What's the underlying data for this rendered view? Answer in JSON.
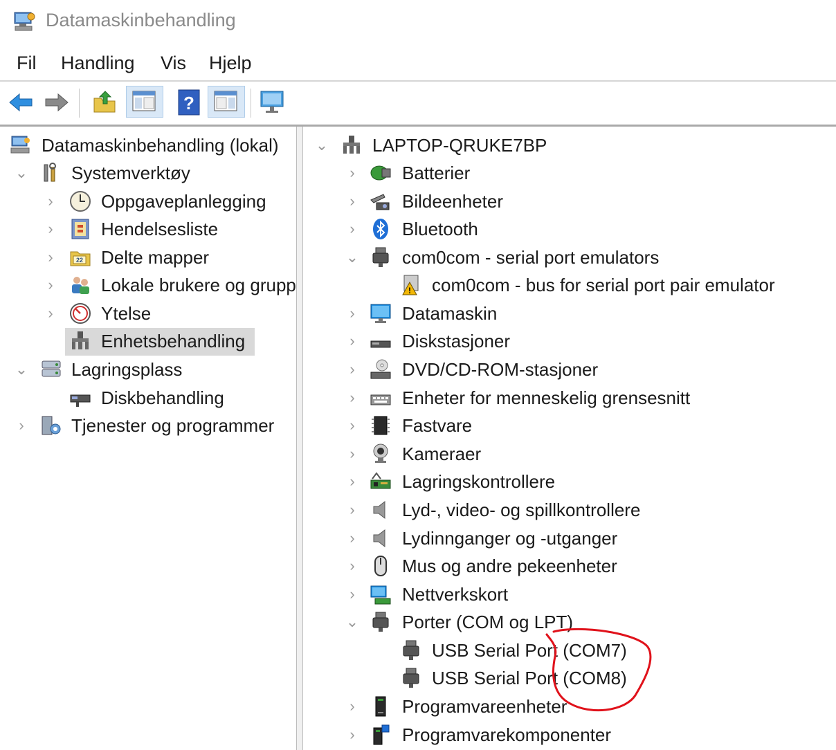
{
  "window": {
    "title": "Datamaskinbehandling"
  },
  "menu": [
    "Fil",
    "Handling",
    "Vis",
    "Hjelp"
  ],
  "toolbar": {
    "buttons": [
      "back-icon",
      "forward-icon",
      "up-folder-icon",
      "show-hide-console-tree-icon",
      "help-icon",
      "show-hide-action-pane-icon",
      "monitor-icon"
    ]
  },
  "tree": {
    "root": "Datamaskinbehandling (lokal)",
    "systemverktoy": "Systemverktøy",
    "oppgaveplanlegging": "Oppgaveplanlegging",
    "hendelsesliste": "Hendelsesliste",
    "delte_mapper": "Delte mapper",
    "lokale_brukere": "Lokale brukere og grupper",
    "ytelse": "Ytelse",
    "enhetsbehandling": "Enhetsbehandling",
    "lagringsplass": "Lagringsplass",
    "diskbehandling": "Diskbehandling",
    "tjenester": "Tjenester og programmer"
  },
  "devices": {
    "computer": "LAPTOP-QRUKE7BP",
    "batterier": "Batterier",
    "bildeenheter": "Bildeenheter",
    "bluetooth": "Bluetooth",
    "com0com": "com0com - serial port emulators",
    "com0com_bus": "com0com - bus for serial port pair emulator",
    "datamaskin": "Datamaskin",
    "diskstasjoner": "Diskstasjoner",
    "dvd": "DVD/CD-ROM-stasjoner",
    "hid": "Enheter for menneskelig grensesnitt",
    "fastvare": "Fastvare",
    "kameraer": "Kameraer",
    "lagringskontrollere": "Lagringskontrollere",
    "lyd_video": "Lyd-, video- og spillkontrollere",
    "lydinnganger": "Lydinnganger og -utganger",
    "mus": "Mus og andre pekeenheter",
    "nettverkskort": "Nettverkskort",
    "porter": "Porter (COM og LPT)",
    "com7": "USB Serial Port (COM7)",
    "com8": "USB Serial Port (COM8)",
    "programvareenheter": "Programvareenheter",
    "programvarekomponenter": "Programvarekomponenter"
  },
  "colors": {
    "selection": "#d9d9d9",
    "annotation": "#e0121b"
  }
}
